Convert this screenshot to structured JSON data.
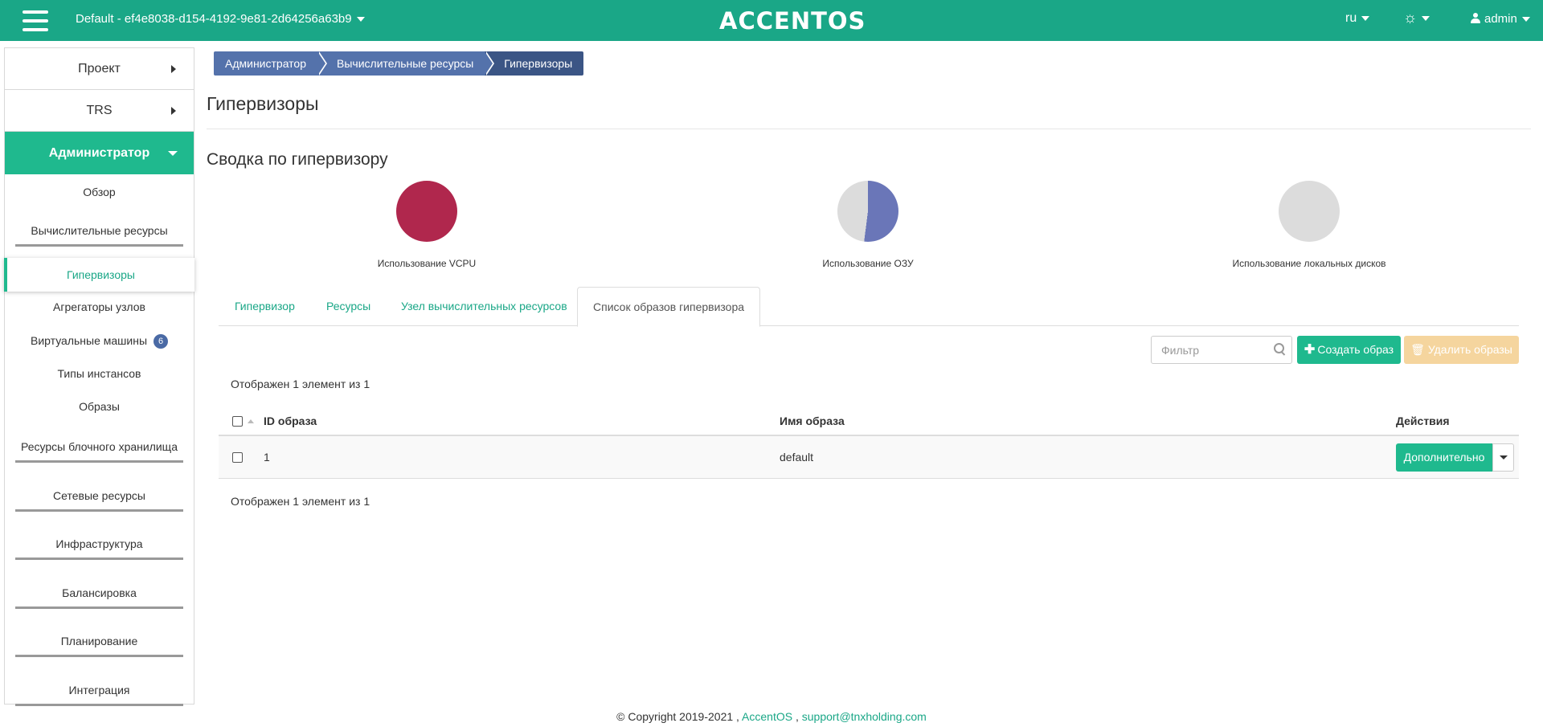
{
  "header": {
    "project": "Default - ef4e8038-d154-4192-9e81-2d64256a63b9",
    "brand": "ACCENTOS",
    "lang": "ru",
    "user": "admin"
  },
  "sidebar": {
    "project": "Проект",
    "trs": "TRS",
    "admin": "Администратор",
    "items": {
      "overview": "Обзор",
      "compute": "Вычислительные ресурсы",
      "hypervisors": "Гипервизоры",
      "aggregates": "Агрегаторы узлов",
      "vms": "Виртуальные машины",
      "vms_count": "6",
      "flavors": "Типы инстансов",
      "images": "Образы",
      "block": "Ресурсы блочного хранилища",
      "network": "Сетевые ресурсы",
      "infra": "Инфраструктура",
      "balancing": "Балансировка",
      "planning": "Планирование",
      "integration": "Интеграция"
    }
  },
  "breadcrumb": [
    "Администратор",
    "Вычислительные ресурсы",
    "Гипервизоры"
  ],
  "page": {
    "title": "Гипервизоры",
    "summary_title": "Сводка по гипервизору"
  },
  "charts": {
    "vcpu": {
      "label": "Использование VCPU",
      "used_fraction": 1.0,
      "color": "#b0274d"
    },
    "ram": {
      "label": "Использование ОЗУ",
      "used_fraction": 0.52,
      "color": "#6a76b8"
    },
    "disk": {
      "label": "Использование локальных дисков",
      "used_fraction": 0.0,
      "color": "#6a76b8"
    }
  },
  "tabs": [
    "Гипервизор",
    "Ресурсы",
    "Узел вычислительных ресурсов",
    "Список образов гипервизора"
  ],
  "toolbar": {
    "filter_placeholder": "Фильтр",
    "create": "Создать образ",
    "delete": "Удалить образы"
  },
  "table": {
    "count_top": "Отображен 1 элемент из 1",
    "count_bottom": "Отображен 1 элемент из 1",
    "columns": [
      "ID образа",
      "Имя образа",
      "Действия"
    ],
    "rows": [
      {
        "id": "1",
        "name": "default",
        "action": "Дополнительно"
      }
    ]
  },
  "footer": {
    "copyright": "© Copyright 2019-2021 ,",
    "link1": "AccentOS",
    "sep": ",",
    "link2": "support@tnxholding.com"
  },
  "colors": {
    "header": "#1aa787",
    "accent": "#1fb98e",
    "breadcrumb": "#5472ab",
    "pie_empty": "#dcdcdc"
  }
}
